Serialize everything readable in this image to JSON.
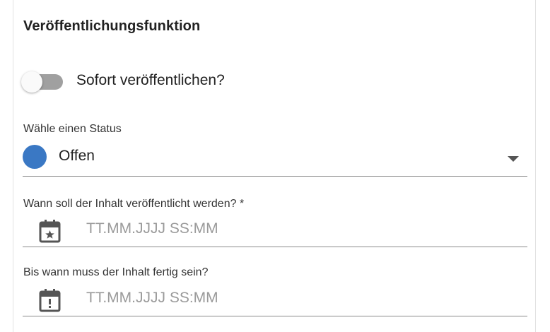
{
  "section": {
    "title": "Veröffentlichungsfunktion"
  },
  "publish_toggle": {
    "label": "Sofort veröffentlichen?",
    "checked": false
  },
  "status_select": {
    "label": "Wähle einen Status",
    "value": "Offen",
    "color": "#3a78c4",
    "icon": "chevron-down-icon"
  },
  "publish_date": {
    "label": "Wann soll der Inhalt veröffentlicht werden? *",
    "placeholder": "TT.MM.JJJJ SS:MM",
    "value": "",
    "icon": "calendar-star-icon"
  },
  "due_date": {
    "label": "Bis wann muss der Inhalt fertig sein?",
    "placeholder": "TT.MM.JJJJ SS:MM",
    "value": "",
    "icon": "calendar-alert-icon"
  }
}
